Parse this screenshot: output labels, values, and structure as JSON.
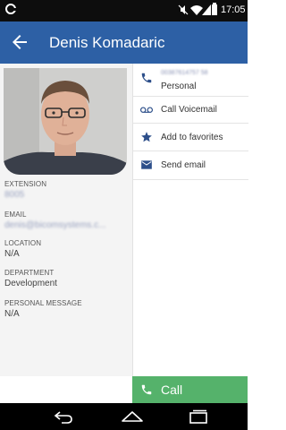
{
  "status_bar": {
    "time": "17:05",
    "icons": [
      "app-notification-icon",
      "mute-icon",
      "wifi-icon",
      "signal-icon",
      "battery-icon"
    ]
  },
  "header": {
    "title": "Denis Komadaric",
    "back_icon": "arrow-left-icon",
    "background": "#2d60a5"
  },
  "contact": {
    "fields": [
      {
        "label": "EXTENSION",
        "value": "8005",
        "obscured": true
      },
      {
        "label": "EMAIL",
        "value": "denis@bicomsystems.c...",
        "obscured": true
      },
      {
        "label": "LOCATION",
        "value": "N/A",
        "obscured": false
      },
      {
        "label": "DEPARTMENT",
        "value": "Development",
        "obscured": false
      },
      {
        "label": "PERSONAL MESSAGE",
        "value": "N/A",
        "obscured": false
      }
    ]
  },
  "actions": {
    "phone": {
      "number": "00387614757 58",
      "label": "Personal"
    },
    "voicemail": {
      "label": "Call Voicemail"
    },
    "favorites": {
      "label": "Add to favorites"
    },
    "email": {
      "label": "Send email"
    }
  },
  "call_button": {
    "label": "Call",
    "color": "#55b26b"
  },
  "nav_bar": {
    "buttons": [
      "back-nav-icon",
      "home-nav-icon",
      "recents-nav-icon"
    ]
  },
  "colors": {
    "accent": "#2d60a5",
    "call": "#55b26b",
    "icon": "#2d4f8a"
  }
}
